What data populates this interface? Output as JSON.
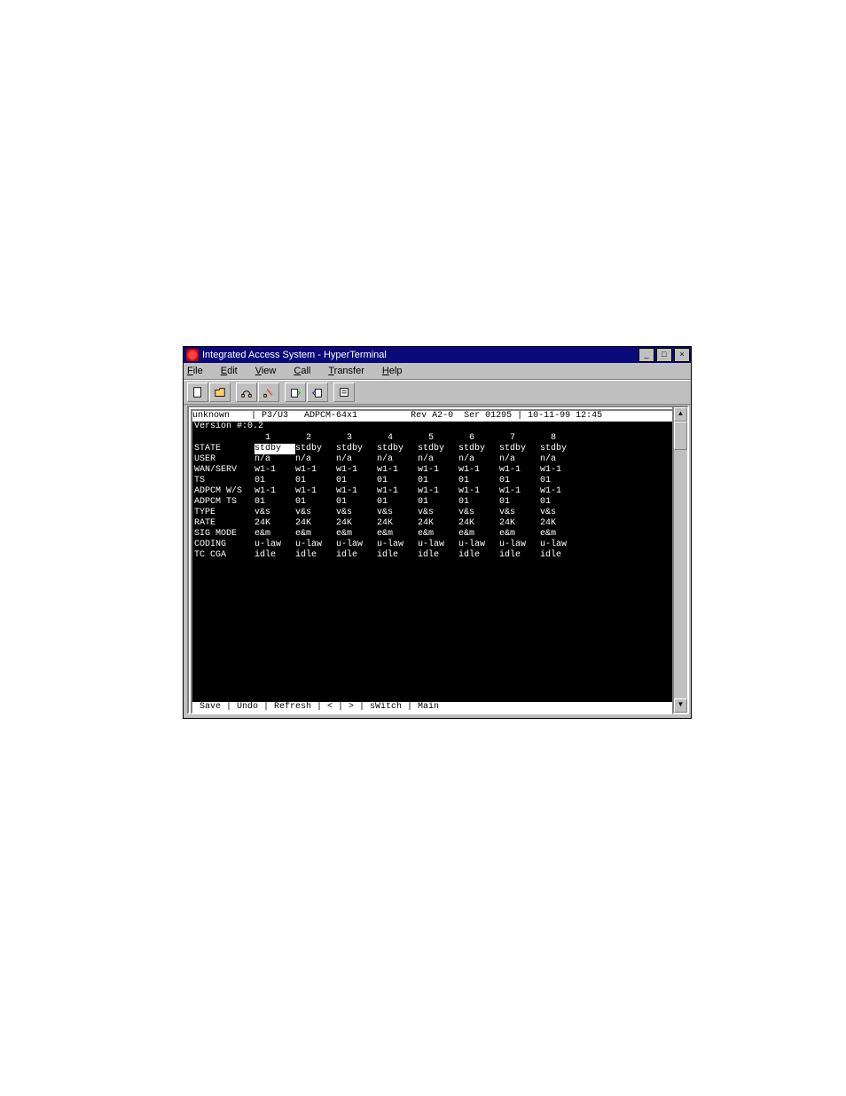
{
  "window": {
    "title": "Integrated Access System - HyperTerminal",
    "minimize": "_",
    "maximize": "□",
    "close": "×"
  },
  "menu": {
    "file": "File",
    "edit": "Edit",
    "view": "View",
    "call": "Call",
    "transfer": "Transfer",
    "help": "Help"
  },
  "toolbar_icons": [
    "new",
    "open",
    "connect",
    "disconnect",
    "send",
    "receive",
    "properties"
  ],
  "scroll": {
    "up": "▲",
    "down": "▼"
  },
  "term_header": {
    "host": "unknown",
    "sep1": "    | ",
    "slot": "P3/U3",
    "card": "   ADPCM-64x1",
    "rev": "          Rev A2-0",
    "ser": "  Ser 01295 | ",
    "time": "10-11-99 12:45"
  },
  "version_line": "Version #:0.2",
  "col_header_label": "",
  "columns": [
    "1",
    "2",
    "3",
    "4",
    "5",
    "6",
    "7",
    "8"
  ],
  "rows": [
    {
      "label": "STATE",
      "cells": [
        "stdby",
        "stdby",
        "stdby",
        "stdby",
        "stdby",
        "stdby",
        "stdby",
        "stdby"
      ],
      "sel": 0
    },
    {
      "label": "USER",
      "cells": [
        "n/a",
        "n/a",
        "n/a",
        "n/a",
        "n/a",
        "n/a",
        "n/a",
        "n/a"
      ]
    },
    {
      "label": "WAN/SERV",
      "cells": [
        "w1-1",
        "w1-1",
        "w1-1",
        "w1-1",
        "w1-1",
        "w1-1",
        "w1-1",
        "w1-1"
      ]
    },
    {
      "label": "TS",
      "cells": [
        "01",
        "01",
        "01",
        "01",
        "01",
        "01",
        "01",
        "01"
      ]
    },
    {
      "label": "ADPCM W/S",
      "cells": [
        "w1-1",
        "w1-1",
        "w1-1",
        "w1-1",
        "w1-1",
        "w1-1",
        "w1-1",
        "w1-1"
      ]
    },
    {
      "label": "ADPCM TS",
      "cells": [
        "01",
        "01",
        "01",
        "01",
        "01",
        "01",
        "01",
        "01"
      ]
    },
    {
      "label": "TYPE",
      "cells": [
        "v&s",
        "v&s",
        "v&s",
        "v&s",
        "v&s",
        "v&s",
        "v&s",
        "v&s"
      ]
    },
    {
      "label": "RATE",
      "cells": [
        "24K",
        "24K",
        "24K",
        "24K",
        "24K",
        "24K",
        "24K",
        "24K"
      ]
    },
    {
      "label": "SIG MODE",
      "cells": [
        "e&m",
        "e&m",
        "e&m",
        "e&m",
        "e&m",
        "e&m",
        "e&m",
        "e&m"
      ]
    },
    {
      "label": "CODING",
      "cells": [
        "u-law",
        "u-law",
        "u-law",
        "u-law",
        "u-law",
        "u-law",
        "u-law",
        "u-law"
      ]
    },
    {
      "label": "TC CGA",
      "cells": [
        "idle",
        "idle",
        "idle",
        "idle",
        "idle",
        "idle",
        "idle",
        "idle"
      ]
    }
  ],
  "footer": " Save | Undo | Refresh | < | > | sWitch | Main"
}
